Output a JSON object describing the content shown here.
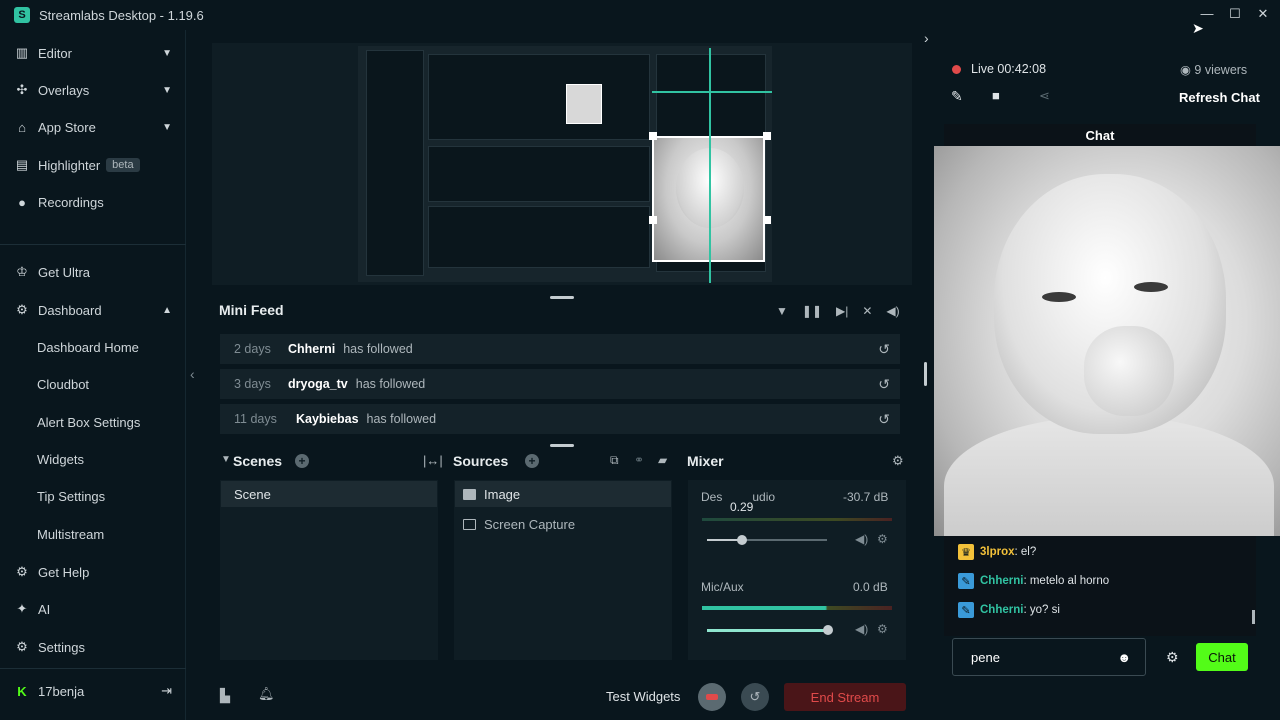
{
  "app": {
    "title": "Streamlabs Desktop - 1.19.6",
    "logo_letter": "S"
  },
  "window_controls": {
    "minimize": "—",
    "maximize": "☐",
    "close": "✕"
  },
  "sidebar": {
    "items": [
      {
        "label": "Editor",
        "icon": "editor-icon"
      },
      {
        "label": "Overlays",
        "icon": "overlays-icon"
      },
      {
        "label": "App Store",
        "icon": "app-store-icon"
      },
      {
        "label": "Highlighter",
        "icon": "highlighter-icon",
        "badge": "beta"
      },
      {
        "label": "Recordings",
        "icon": "recordings-icon"
      },
      {
        "label": "Get Ultra",
        "icon": "ultra-icon"
      },
      {
        "label": "Dashboard",
        "icon": "dashboard-icon"
      }
    ],
    "dashboard_sub": [
      "Dashboard Home",
      "Cloudbot",
      "Alert Box Settings",
      "Widgets",
      "Tip Settings",
      "Multistream"
    ],
    "bottom_items": [
      {
        "label": "Get Help",
        "icon": "help-icon"
      },
      {
        "label": "AI",
        "icon": "ai-icon"
      },
      {
        "label": "Settings",
        "icon": "settings-icon"
      }
    ],
    "user": {
      "name": "17benja",
      "platform_letter": "K"
    }
  },
  "minifeed": {
    "title": "Mini Feed",
    "rows": [
      {
        "when": "2 days",
        "who": "Chherni",
        "what": "has followed"
      },
      {
        "when": "3 days",
        "who": "dryoga_tv",
        "what": "has followed"
      },
      {
        "when": "11 days",
        "who": "Kaybiebas",
        "what": "has followed"
      }
    ]
  },
  "scenes": {
    "title": "Scenes",
    "items": [
      "Scene"
    ]
  },
  "sources": {
    "title": "Sources",
    "items": [
      "Image",
      "Screen Capture"
    ]
  },
  "mixer": {
    "title": "Mixer",
    "channels": [
      {
        "name": "Des",
        "name_tail": "udio",
        "db": "-30.7 dB",
        "tooltip": "0.29",
        "level": 0.29
      },
      {
        "name": "Mic/Aux",
        "db": "0.0 dB",
        "level": 1.0
      }
    ]
  },
  "bottom": {
    "test_widgets": "Test Widgets",
    "end_stream": "End Stream"
  },
  "stream": {
    "live_label": "Live 00:42:08",
    "viewers": "9 viewers",
    "refresh_chat": "Refresh Chat",
    "chat_title": "Chat"
  },
  "chat": {
    "messages": [
      {
        "user": "3lprox",
        "text": "el?",
        "badge_color": "#f3c13a"
      },
      {
        "user": "Chherni",
        "text": "metelo al horno",
        "badge_color": "#3a9ad9"
      },
      {
        "user": "Chherni",
        "text": "yo? si",
        "badge_color": "#3a9ad9"
      }
    ],
    "input_value": "pene",
    "send_label": "Chat"
  },
  "colors": {
    "accent": "#31c3a2",
    "kick_green": "#53fc18",
    "live_red": "#e04a4a"
  }
}
